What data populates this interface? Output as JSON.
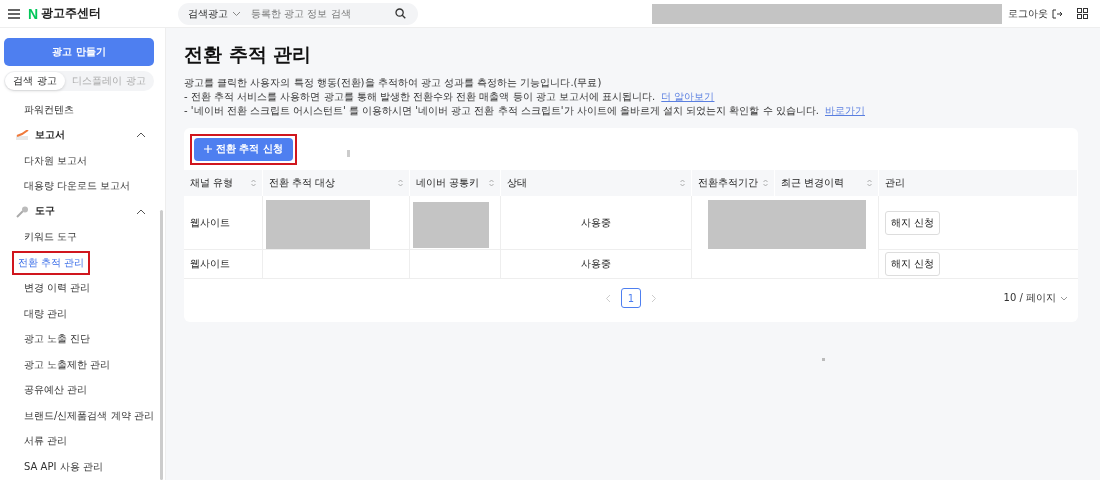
{
  "header": {
    "brand_letter": "N",
    "brand": "광고주센터",
    "search_scope": "검색광고",
    "search": {
      "placeholder": "등록한 광고 정보 검색"
    },
    "logout": "로그아웃"
  },
  "sidebar": {
    "create_button": "광고 만들기",
    "tabs": [
      {
        "label": "검색 광고",
        "selected": true
      },
      {
        "label": "디스플레이 광고",
        "selected": false
      }
    ],
    "items": [
      {
        "kind": "item",
        "label": "파워컨텐츠",
        "selected": false
      },
      {
        "kind": "section",
        "label": "보고서",
        "expanded": true
      },
      {
        "kind": "item",
        "label": "다차원 보고서",
        "selected": false
      },
      {
        "kind": "item",
        "label": "대용량 다운로드 보고서",
        "selected": false
      },
      {
        "kind": "section",
        "label": "도구",
        "expanded": true
      },
      {
        "kind": "item",
        "label": "키워드 도구",
        "selected": false
      },
      {
        "kind": "item",
        "label": "전환 추적 관리",
        "selected": true,
        "highlighted": true
      },
      {
        "kind": "item",
        "label": "변경 이력 관리",
        "selected": false
      },
      {
        "kind": "item",
        "label": "대량 관리",
        "selected": false
      },
      {
        "kind": "item",
        "label": "광고 노출 진단",
        "selected": false
      },
      {
        "kind": "item",
        "label": "광고 노출제한 관리",
        "selected": false
      },
      {
        "kind": "item",
        "label": "공유예산 관리",
        "selected": false
      },
      {
        "kind": "item",
        "label": "브랜드/신제품검색 계약 관리",
        "selected": false
      },
      {
        "kind": "item",
        "label": "서류 관리",
        "selected": false
      },
      {
        "kind": "item",
        "label": "SA API 사용 관리",
        "selected": false
      }
    ]
  },
  "page": {
    "title": "전환 추적 관리",
    "description": [
      "광고를 클릭한 사용자의 특정 행동(전환)을 추적하여 광고 성과를 측정하는 기능입니다.(무료)",
      "- 전환 추적 서비스를 사용하면 광고를 통해 발생한 전환수와 전환 매출액 등이 광고 보고서에 표시됩니다.",
      "- '네이버 전환 스크립트 어시스턴트' 를 이용하시면 '네이버 광고 전환 추적 스크립트'가 사이트에 올바르게 설치 되었는지 확인할 수 있습니다."
    ],
    "links": [
      "더 알아보기",
      "바로가기"
    ],
    "add_button": {
      "label": "전환 추적 신청",
      "highlighted": true
    }
  },
  "table": {
    "columns": [
      {
        "label": "채널 유형",
        "sortable": true
      },
      {
        "label": "전환 추적 대상",
        "sortable": true
      },
      {
        "label": "네이버 공통키",
        "sortable": true
      },
      {
        "label": "상태",
        "sortable": true
      },
      {
        "label": "전환추적기간",
        "sortable": true
      },
      {
        "label": "최근 변경이력",
        "sortable": true
      },
      {
        "label": "관리",
        "sortable": false
      }
    ],
    "rows": [
      {
        "channel": "웹사이트",
        "status": "사용중",
        "action": "해지 신청"
      },
      {
        "channel": "웹사이트",
        "status": "사용중",
        "action": "해지 신청"
      }
    ]
  },
  "pagination": {
    "pages": [
      {
        "label": "1",
        "selected": true
      }
    ],
    "page_size": "10 / 페이지"
  }
}
